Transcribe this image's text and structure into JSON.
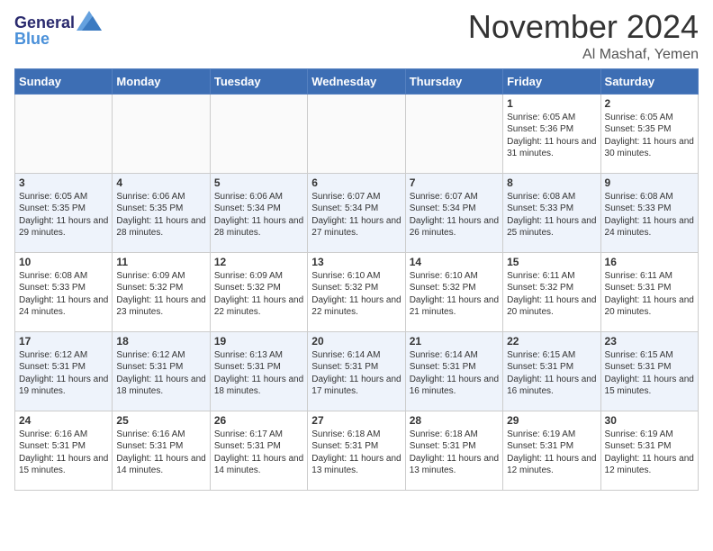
{
  "header": {
    "logo_line1": "General",
    "logo_line2": "Blue",
    "month": "November 2024",
    "location": "Al Mashaf, Yemen"
  },
  "weekdays": [
    "Sunday",
    "Monday",
    "Tuesday",
    "Wednesday",
    "Thursday",
    "Friday",
    "Saturday"
  ],
  "weeks": [
    [
      {
        "day": "",
        "sunrise": "",
        "sunset": "",
        "daylight": ""
      },
      {
        "day": "",
        "sunrise": "",
        "sunset": "",
        "daylight": ""
      },
      {
        "day": "",
        "sunrise": "",
        "sunset": "",
        "daylight": ""
      },
      {
        "day": "",
        "sunrise": "",
        "sunset": "",
        "daylight": ""
      },
      {
        "day": "",
        "sunrise": "",
        "sunset": "",
        "daylight": ""
      },
      {
        "day": "1",
        "sunrise": "Sunrise: 6:05 AM",
        "sunset": "Sunset: 5:36 PM",
        "daylight": "Daylight: 11 hours and 31 minutes."
      },
      {
        "day": "2",
        "sunrise": "Sunrise: 6:05 AM",
        "sunset": "Sunset: 5:35 PM",
        "daylight": "Daylight: 11 hours and 30 minutes."
      }
    ],
    [
      {
        "day": "3",
        "sunrise": "Sunrise: 6:05 AM",
        "sunset": "Sunset: 5:35 PM",
        "daylight": "Daylight: 11 hours and 29 minutes."
      },
      {
        "day": "4",
        "sunrise": "Sunrise: 6:06 AM",
        "sunset": "Sunset: 5:35 PM",
        "daylight": "Daylight: 11 hours and 28 minutes."
      },
      {
        "day": "5",
        "sunrise": "Sunrise: 6:06 AM",
        "sunset": "Sunset: 5:34 PM",
        "daylight": "Daylight: 11 hours and 28 minutes."
      },
      {
        "day": "6",
        "sunrise": "Sunrise: 6:07 AM",
        "sunset": "Sunset: 5:34 PM",
        "daylight": "Daylight: 11 hours and 27 minutes."
      },
      {
        "day": "7",
        "sunrise": "Sunrise: 6:07 AM",
        "sunset": "Sunset: 5:34 PM",
        "daylight": "Daylight: 11 hours and 26 minutes."
      },
      {
        "day": "8",
        "sunrise": "Sunrise: 6:08 AM",
        "sunset": "Sunset: 5:33 PM",
        "daylight": "Daylight: 11 hours and 25 minutes."
      },
      {
        "day": "9",
        "sunrise": "Sunrise: 6:08 AM",
        "sunset": "Sunset: 5:33 PM",
        "daylight": "Daylight: 11 hours and 24 minutes."
      }
    ],
    [
      {
        "day": "10",
        "sunrise": "Sunrise: 6:08 AM",
        "sunset": "Sunset: 5:33 PM",
        "daylight": "Daylight: 11 hours and 24 minutes."
      },
      {
        "day": "11",
        "sunrise": "Sunrise: 6:09 AM",
        "sunset": "Sunset: 5:32 PM",
        "daylight": "Daylight: 11 hours and 23 minutes."
      },
      {
        "day": "12",
        "sunrise": "Sunrise: 6:09 AM",
        "sunset": "Sunset: 5:32 PM",
        "daylight": "Daylight: 11 hours and 22 minutes."
      },
      {
        "day": "13",
        "sunrise": "Sunrise: 6:10 AM",
        "sunset": "Sunset: 5:32 PM",
        "daylight": "Daylight: 11 hours and 22 minutes."
      },
      {
        "day": "14",
        "sunrise": "Sunrise: 6:10 AM",
        "sunset": "Sunset: 5:32 PM",
        "daylight": "Daylight: 11 hours and 21 minutes."
      },
      {
        "day": "15",
        "sunrise": "Sunrise: 6:11 AM",
        "sunset": "Sunset: 5:32 PM",
        "daylight": "Daylight: 11 hours and 20 minutes."
      },
      {
        "day": "16",
        "sunrise": "Sunrise: 6:11 AM",
        "sunset": "Sunset: 5:31 PM",
        "daylight": "Daylight: 11 hours and 20 minutes."
      }
    ],
    [
      {
        "day": "17",
        "sunrise": "Sunrise: 6:12 AM",
        "sunset": "Sunset: 5:31 PM",
        "daylight": "Daylight: 11 hours and 19 minutes."
      },
      {
        "day": "18",
        "sunrise": "Sunrise: 6:12 AM",
        "sunset": "Sunset: 5:31 PM",
        "daylight": "Daylight: 11 hours and 18 minutes."
      },
      {
        "day": "19",
        "sunrise": "Sunrise: 6:13 AM",
        "sunset": "Sunset: 5:31 PM",
        "daylight": "Daylight: 11 hours and 18 minutes."
      },
      {
        "day": "20",
        "sunrise": "Sunrise: 6:14 AM",
        "sunset": "Sunset: 5:31 PM",
        "daylight": "Daylight: 11 hours and 17 minutes."
      },
      {
        "day": "21",
        "sunrise": "Sunrise: 6:14 AM",
        "sunset": "Sunset: 5:31 PM",
        "daylight": "Daylight: 11 hours and 16 minutes."
      },
      {
        "day": "22",
        "sunrise": "Sunrise: 6:15 AM",
        "sunset": "Sunset: 5:31 PM",
        "daylight": "Daylight: 11 hours and 16 minutes."
      },
      {
        "day": "23",
        "sunrise": "Sunrise: 6:15 AM",
        "sunset": "Sunset: 5:31 PM",
        "daylight": "Daylight: 11 hours and 15 minutes."
      }
    ],
    [
      {
        "day": "24",
        "sunrise": "Sunrise: 6:16 AM",
        "sunset": "Sunset: 5:31 PM",
        "daylight": "Daylight: 11 hours and 15 minutes."
      },
      {
        "day": "25",
        "sunrise": "Sunrise: 6:16 AM",
        "sunset": "Sunset: 5:31 PM",
        "daylight": "Daylight: 11 hours and 14 minutes."
      },
      {
        "day": "26",
        "sunrise": "Sunrise: 6:17 AM",
        "sunset": "Sunset: 5:31 PM",
        "daylight": "Daylight: 11 hours and 14 minutes."
      },
      {
        "day": "27",
        "sunrise": "Sunrise: 6:18 AM",
        "sunset": "Sunset: 5:31 PM",
        "daylight": "Daylight: 11 hours and 13 minutes."
      },
      {
        "day": "28",
        "sunrise": "Sunrise: 6:18 AM",
        "sunset": "Sunset: 5:31 PM",
        "daylight": "Daylight: 11 hours and 13 minutes."
      },
      {
        "day": "29",
        "sunrise": "Sunrise: 6:19 AM",
        "sunset": "Sunset: 5:31 PM",
        "daylight": "Daylight: 11 hours and 12 minutes."
      },
      {
        "day": "30",
        "sunrise": "Sunrise: 6:19 AM",
        "sunset": "Sunset: 5:31 PM",
        "daylight": "Daylight: 11 hours and 12 minutes."
      }
    ]
  ]
}
